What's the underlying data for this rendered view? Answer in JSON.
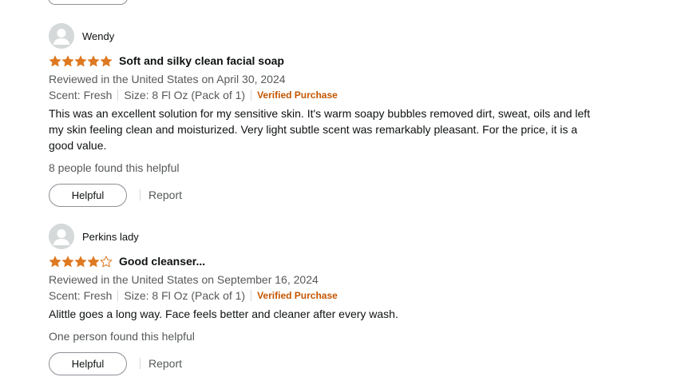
{
  "colors": {
    "star": "#de7921",
    "verified": "#c45500",
    "muted_text": "#565959",
    "avatar_bg": "#d5d9d9"
  },
  "reviews": [
    {
      "author": "Wendy",
      "rating": 5,
      "max_rating": 5,
      "title": "Soft and silky clean facial soap",
      "date": "Reviewed in the United States on April 30, 2024",
      "scent": "Scent: Fresh",
      "size": "Size: 8 Fl Oz (Pack of 1)",
      "verified": "Verified Purchase",
      "body": "This was an excellent solution for my sensitive skin. It's warm soapy bubbles removed dirt, sweat, oils and left my skin feeling clean and moisturized. Very light subtle scent was remarkably pleasant. For the price, it is a good value.",
      "helpful_count": "8 people found this helpful",
      "helpful_label": "Helpful",
      "report_label": "Report",
      "avatar_icon": "user-silhouette-icon"
    },
    {
      "author": "Perkins lady",
      "rating": 4,
      "max_rating": 5,
      "title": "Good cleanser...",
      "date": "Reviewed in the United States on September 16, 2024",
      "scent": "Scent: Fresh",
      "size": "Size: 8 Fl Oz (Pack of 1)",
      "verified": "Verified Purchase",
      "body": "Alittle goes a long way. Face feels better and cleaner after every wash.",
      "helpful_count": "One person found this helpful",
      "helpful_label": "Helpful",
      "report_label": "Report",
      "avatar_icon": "user-silhouette-icon"
    }
  ]
}
